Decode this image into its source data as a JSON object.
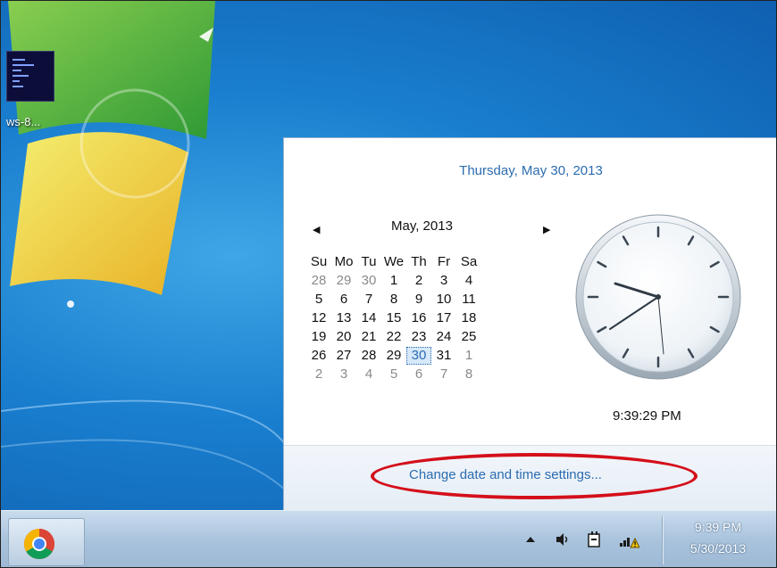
{
  "desktop": {
    "icon_label": "ws-8..."
  },
  "popup": {
    "long_date": "Thursday, May 30, 2013",
    "month_title": "May, 2013",
    "prev_glyph": "◀",
    "next_glyph": "▶",
    "weekdays": [
      "Su",
      "Mo",
      "Tu",
      "We",
      "Th",
      "Fr",
      "Sa"
    ],
    "weeks": [
      [
        "28",
        "29",
        "30",
        "1",
        "2",
        "3",
        "4"
      ],
      [
        "5",
        "6",
        "7",
        "8",
        "9",
        "10",
        "11"
      ],
      [
        "12",
        "13",
        "14",
        "15",
        "16",
        "17",
        "18"
      ],
      [
        "19",
        "20",
        "21",
        "22",
        "23",
        "24",
        "25"
      ],
      [
        "26",
        "27",
        "28",
        "29",
        "30",
        "31",
        "1"
      ],
      [
        "2",
        "3",
        "4",
        "5",
        "6",
        "7",
        "8"
      ]
    ],
    "selected_day": "30",
    "digital_time": "9:39:29 PM",
    "change_link": "Change date and time settings..."
  },
  "taskbar": {
    "tray_time": "9:39 PM",
    "tray_date": "5/30/2013",
    "icons": [
      "show-hidden-icons-icon",
      "volume-icon",
      "power-icon",
      "network-warning-icon"
    ]
  },
  "colors": {
    "link": "#2b6cb0",
    "highlight": "#d40f1a"
  }
}
